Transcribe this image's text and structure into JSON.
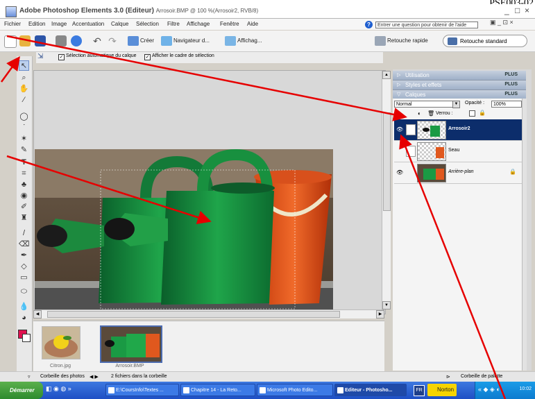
{
  "doc_ref": "PSE003-02",
  "window": {
    "title": "Adobe Photoshop Elements 3.0 (Editeur)",
    "subtitle": "Arrosoir.BMP @ 100 %(Arrosoir2, RVB/8)",
    "controls": [
      "_",
      "□",
      "×"
    ]
  },
  "menu": [
    "Fichier",
    "Edition",
    "Image",
    "Accentuation",
    "Calque",
    "Sélection",
    "Filtre",
    "Affichage",
    "Fenêtre",
    "Aide"
  ],
  "help": {
    "placeholder": "Entrer une question pour obtenir de l'aide"
  },
  "toolbar": {
    "create_label": "Créer",
    "navigator_label": "Navigateur d...",
    "display_label": "Affichag...",
    "quick_fix_label": "Retouche rapide",
    "standard_edit_label": "Retouche standard"
  },
  "options_bar": {
    "auto_select_label": "Sélection automatique du calque",
    "show_bounding_label": "Afficher le cadre de sélection",
    "auto_select_checked": true,
    "show_bounding_checked": true
  },
  "palettes": {
    "items": [
      {
        "name": "Utilisation",
        "more": "PLUS"
      },
      {
        "name": "Styles et effets",
        "more": "PLUS"
      },
      {
        "name": "Calques",
        "more": "PLUS"
      }
    ]
  },
  "layers": {
    "blend_mode": "Normal",
    "opacity_label": "Opacité :",
    "opacity_value": "100%",
    "lock_label": "Verrou :",
    "rows": [
      {
        "name": "Arrosoir2",
        "selected": true
      },
      {
        "name": "Seau",
        "selected": false
      },
      {
        "name": "Arrière-plan",
        "selected": false
      }
    ]
  },
  "photo_bin": {
    "thumbnails": [
      {
        "label": "Citron.jpg"
      },
      {
        "label": "Arrosoir.BMP"
      }
    ],
    "footer_left": "Corbeille des photos",
    "footer_count": "2 fichiers dans la corbeille",
    "footer_right": "Corbeille de palette"
  },
  "taskbar": {
    "start_label": "Démarrer",
    "tasks": [
      {
        "label": "E:\\CoursInfo\\Textes ..."
      },
      {
        "label": "Chapitre 14 - La Reto..."
      },
      {
        "label": "Microsoft Photo Edito..."
      },
      {
        "label": "Editeur - Photosho..."
      }
    ],
    "norton_label": "Norton",
    "clock": "10:02"
  },
  "colors": {
    "foreground": "#e0114f",
    "background": "#ffffff",
    "selection": "#0c2d6b",
    "annotation_arrow": "#e60000"
  }
}
